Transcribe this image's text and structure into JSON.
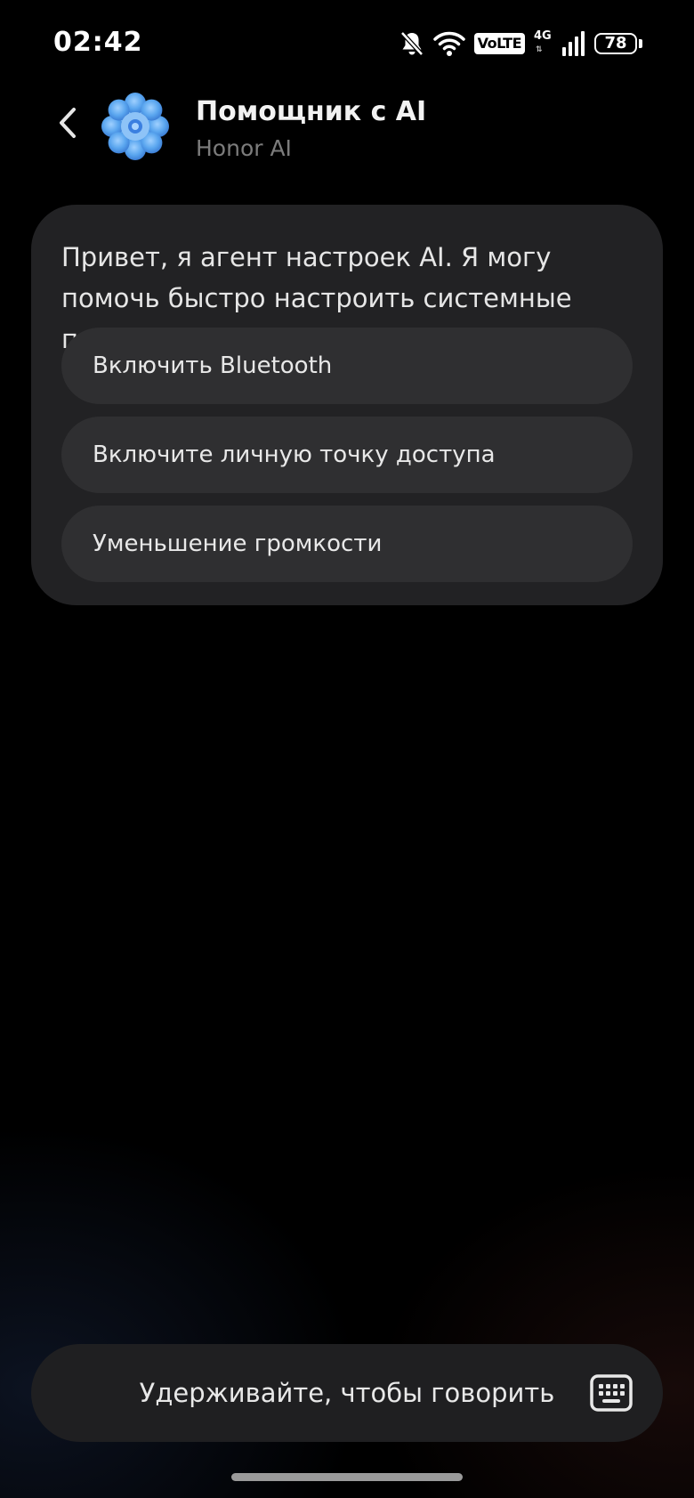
{
  "status_bar": {
    "time": "02:42",
    "volte": "VoLTE",
    "network": "4G",
    "battery": "78",
    "icons": [
      "bell-muted-icon",
      "wifi-icon",
      "volte-icon",
      "signal-icon",
      "battery-icon"
    ]
  },
  "header": {
    "title": "Помощник с AI",
    "subtitle": "Honor AI",
    "back_icon": "chevron-left-icon",
    "logo_icon": "ai-assistant-logo-icon"
  },
  "card": {
    "greeting": "Привет, я агент настроек AI. Я могу помочь быстро настроить системные параметры.",
    "suggestions": [
      {
        "label": "Включить Bluetooth"
      },
      {
        "label": "Включите личную точку доступа"
      },
      {
        "label": "Уменьшение громкости"
      }
    ]
  },
  "bottom": {
    "hold_to_speak": "Удерживайте, чтобы говорить",
    "keyboard_icon": "keyboard-icon"
  },
  "colors": {
    "background": "#000000",
    "card": "#222224",
    "chip": "#2f2f31",
    "logo_blue": "#5aa6ef"
  }
}
